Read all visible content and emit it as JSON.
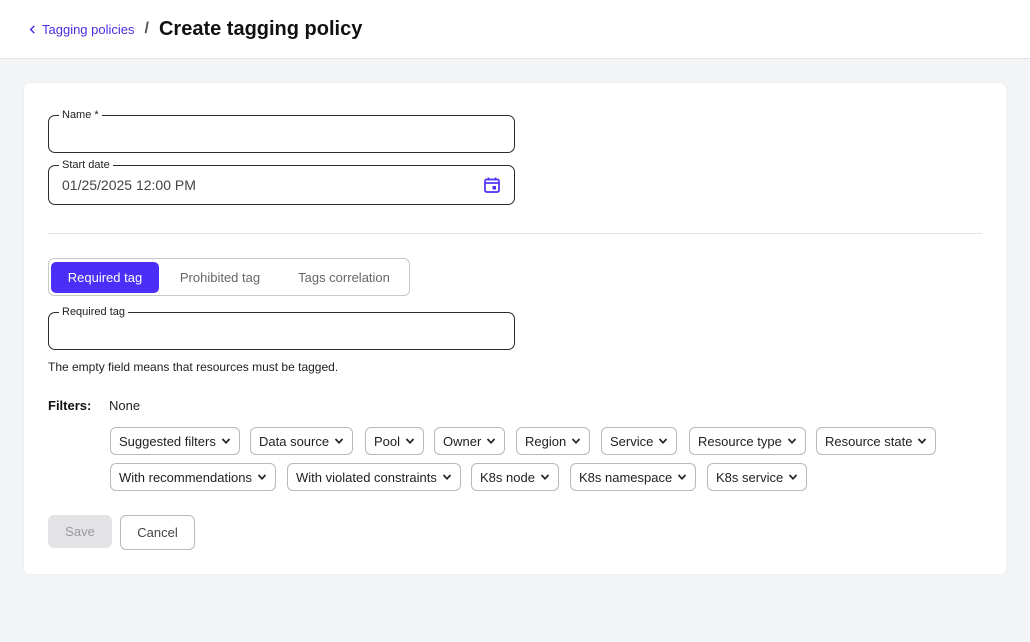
{
  "breadcrumb": {
    "back_label": "Tagging policies",
    "separator": "/"
  },
  "page_title": "Create tagging policy",
  "form": {
    "name": {
      "label": "Name *",
      "value": ""
    },
    "start_date": {
      "label": "Start date",
      "value": "01/25/2025 12:00 PM"
    }
  },
  "tabs": [
    {
      "label": "Required tag",
      "active": true
    },
    {
      "label": "Prohibited tag",
      "active": false
    },
    {
      "label": "Tags correlation",
      "active": false
    }
  ],
  "required_tag": {
    "label": "Required tag",
    "value": ""
  },
  "helper_text": "The empty field means that resources must be tagged.",
  "filters": {
    "label": "Filters:",
    "value": "None",
    "chips": [
      "Suggested filters",
      "Data source",
      "Pool",
      "Owner",
      "Region",
      "Service",
      "Resource type",
      "Resource state",
      "With recommendations",
      "With violated constraints",
      "K8s node",
      "K8s namespace",
      "K8s service"
    ]
  },
  "actions": {
    "save_label": "Save",
    "cancel_label": "Cancel"
  },
  "colors": {
    "accent": "#4b2ef7",
    "link": "#4b2ee0",
    "background": "#f3f4f6"
  }
}
